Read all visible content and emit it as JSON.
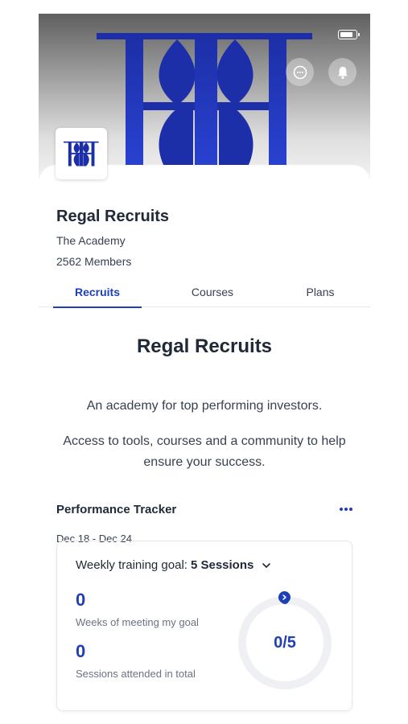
{
  "header": {
    "chat_icon": "chat-bubble-icon",
    "notification_icon": "bell-icon",
    "battery_icon": "battery-icon"
  },
  "group": {
    "name": "Regal Recruits",
    "subtitle": "The Academy",
    "members": "2562 Members"
  },
  "tabs": [
    {
      "label": "Recruits",
      "active": true
    },
    {
      "label": "Courses",
      "active": false
    },
    {
      "label": "Plans",
      "active": false
    }
  ],
  "about": {
    "title": "Regal Recruits",
    "description_line1": "An academy for top performing investors.",
    "description_line2": "Access to tools, courses and a community to help ensure your success."
  },
  "tracker": {
    "title": "Performance Tracker",
    "date_range": "Dec 18 - Dec 24",
    "goal_label": "Weekly training goal:",
    "goal_value": "5 Sessions",
    "weeks_met_value": "0",
    "weeks_met_label": "Weeks of meeting my goal",
    "sessions_value": "0",
    "sessions_label": "Sessions attended in total",
    "progress_text": "0/5",
    "progress_fraction": 0
  },
  "colors": {
    "accent": "#1d3fb8",
    "logo_blue": "#1f35b5"
  }
}
